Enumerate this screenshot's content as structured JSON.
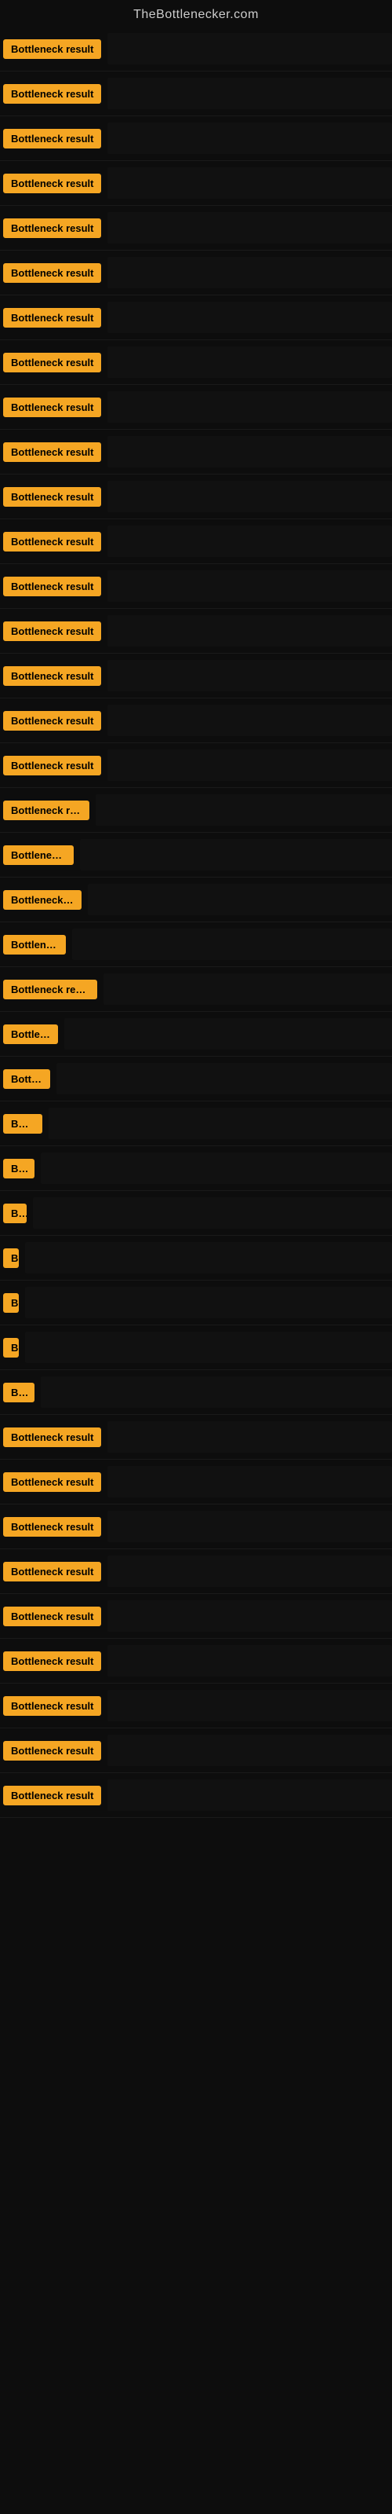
{
  "site": {
    "title": "TheBottlenecker.com"
  },
  "badge_label": "Bottleneck result",
  "rows": [
    {
      "id": 1,
      "badge_class": "badge-full"
    },
    {
      "id": 2,
      "badge_class": "badge-full"
    },
    {
      "id": 3,
      "badge_class": "badge-full"
    },
    {
      "id": 4,
      "badge_class": "badge-full"
    },
    {
      "id": 5,
      "badge_class": "badge-full"
    },
    {
      "id": 6,
      "badge_class": "badge-full"
    },
    {
      "id": 7,
      "badge_class": "badge-full"
    },
    {
      "id": 8,
      "badge_class": "badge-full"
    },
    {
      "id": 9,
      "badge_class": "badge-full"
    },
    {
      "id": 10,
      "badge_class": "badge-full"
    },
    {
      "id": 11,
      "badge_class": "badge-full"
    },
    {
      "id": 12,
      "badge_class": "badge-full"
    },
    {
      "id": 13,
      "badge_class": "badge-full"
    },
    {
      "id": 14,
      "badge_class": "badge-full"
    },
    {
      "id": 15,
      "badge_class": "badge-full"
    },
    {
      "id": 16,
      "badge_class": "badge-w130"
    },
    {
      "id": 17,
      "badge_class": "badge-full"
    },
    {
      "id": 18,
      "badge_class": "badge-w110"
    },
    {
      "id": 19,
      "badge_class": "badge-w90"
    },
    {
      "id": 20,
      "badge_class": "badge-w100"
    },
    {
      "id": 21,
      "badge_class": "badge-w80"
    },
    {
      "id": 22,
      "badge_class": "badge-w120"
    },
    {
      "id": 23,
      "badge_class": "badge-w70"
    },
    {
      "id": 24,
      "badge_class": "badge-w60"
    },
    {
      "id": 25,
      "badge_class": "badge-w50"
    },
    {
      "id": 26,
      "badge_class": "badge-w40"
    },
    {
      "id": 27,
      "badge_class": "badge-w30"
    },
    {
      "id": 28,
      "badge_class": "badge-w10"
    },
    {
      "id": 29,
      "badge_class": "badge-w10"
    },
    {
      "id": 30,
      "badge_class": "badge-w10"
    },
    {
      "id": 31,
      "badge_class": "badge-w40"
    },
    {
      "id": 32,
      "badge_class": "badge-full"
    },
    {
      "id": 33,
      "badge_class": "badge-full"
    },
    {
      "id": 34,
      "badge_class": "badge-full"
    },
    {
      "id": 35,
      "badge_class": "badge-full"
    },
    {
      "id": 36,
      "badge_class": "badge-full"
    },
    {
      "id": 37,
      "badge_class": "badge-full"
    },
    {
      "id": 38,
      "badge_class": "badge-full"
    },
    {
      "id": 39,
      "badge_class": "badge-full"
    },
    {
      "id": 40,
      "badge_class": "badge-full"
    }
  ]
}
